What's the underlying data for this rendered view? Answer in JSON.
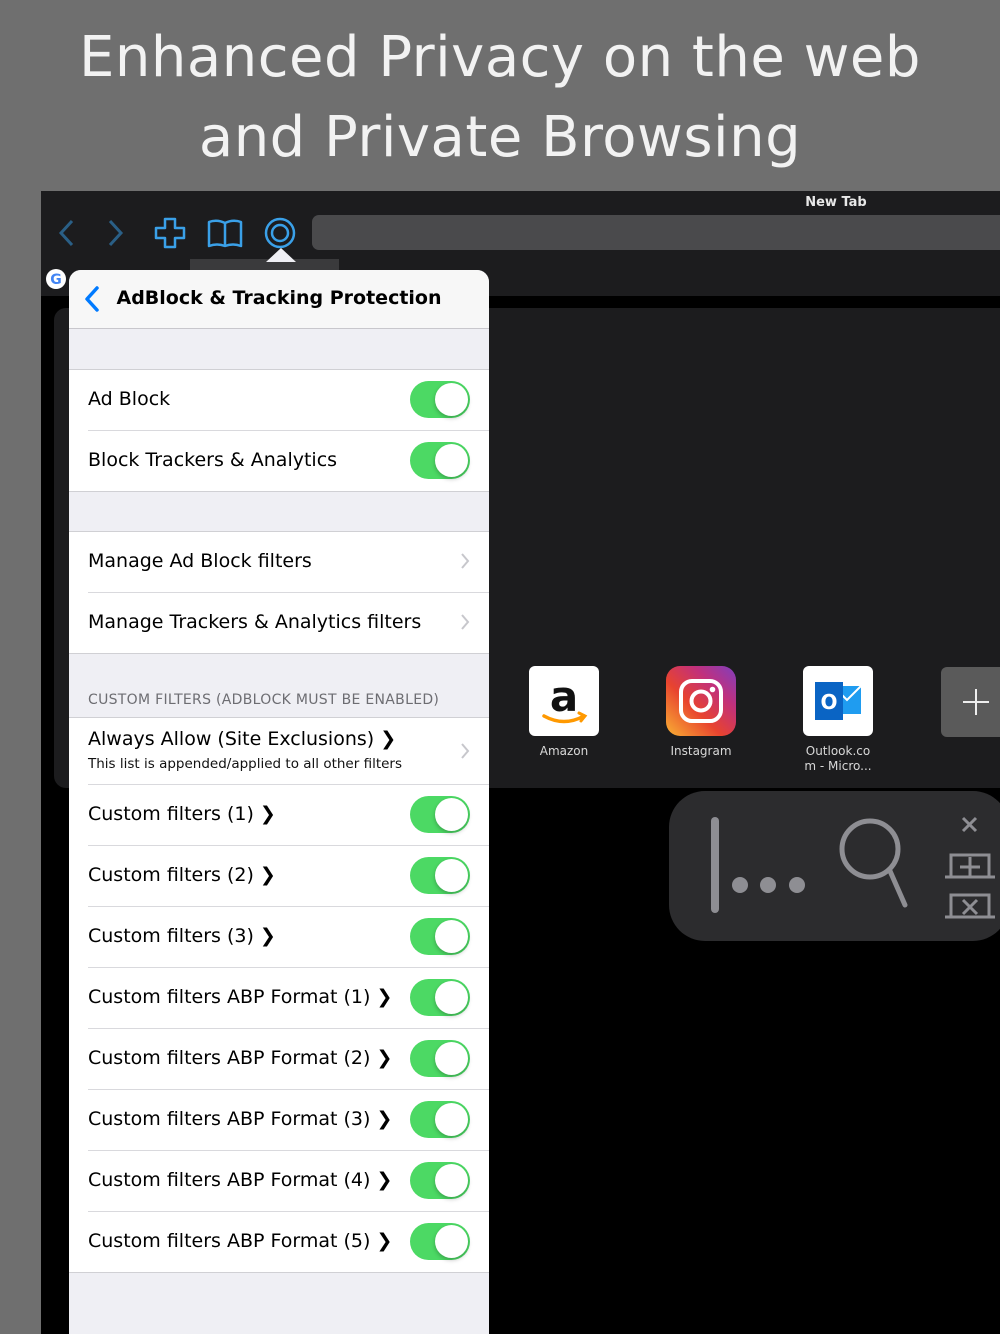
{
  "headline": {
    "line1": "Enhanced Privacy on the web",
    "line2": "and Private Browsing"
  },
  "browser": {
    "tab_title": "New Tab",
    "toolbar_icons": [
      "back-icon",
      "forward-icon",
      "new-tab-plus-icon",
      "bookmarks-book-icon",
      "privacy-target-icon"
    ]
  },
  "favorites": [
    {
      "name": "Amazon",
      "icon": "amazon-logo"
    },
    {
      "name": "Instagram",
      "icon": "instagram-logo"
    },
    {
      "name": "Outlook.co\nm - Micro...",
      "icon": "outlook-logo"
    }
  ],
  "settings": {
    "title": "AdBlock & Tracking Protection",
    "group1": [
      {
        "label": "Ad Block",
        "enabled": true
      },
      {
        "label": "Block Trackers & Analytics",
        "enabled": true
      }
    ],
    "group2": [
      {
        "label": "Manage Ad Block filters"
      },
      {
        "label": "Manage Trackers & Analytics filters"
      }
    ],
    "custom_header": "CUSTOM FILTERS (ADBLOCK MUST BE ENABLED)",
    "always_allow": {
      "label": "Always Allow (Site Exclusions) ❯",
      "subtitle": "This list is appended/applied to all other filters"
    },
    "custom_filters": [
      {
        "label": "Custom filters (1) ❯",
        "enabled": true
      },
      {
        "label": "Custom filters (2) ❯",
        "enabled": true
      },
      {
        "label": "Custom filters (3) ❯",
        "enabled": true
      },
      {
        "label": "Custom filters ABP Format (1) ❯",
        "enabled": true
      },
      {
        "label": "Custom filters ABP Format (2) ❯",
        "enabled": true
      },
      {
        "label": "Custom filters ABP Format (3) ❯",
        "enabled": true
      },
      {
        "label": "Custom filters ABP Format (4) ❯",
        "enabled": true
      },
      {
        "label": "Custom filters ABP Format (5) ❯",
        "enabled": true
      }
    ]
  },
  "colors": {
    "toggle_on": "#4cd964",
    "accent": "#007aff",
    "toolbar_icon": "#3aa0e8"
  }
}
